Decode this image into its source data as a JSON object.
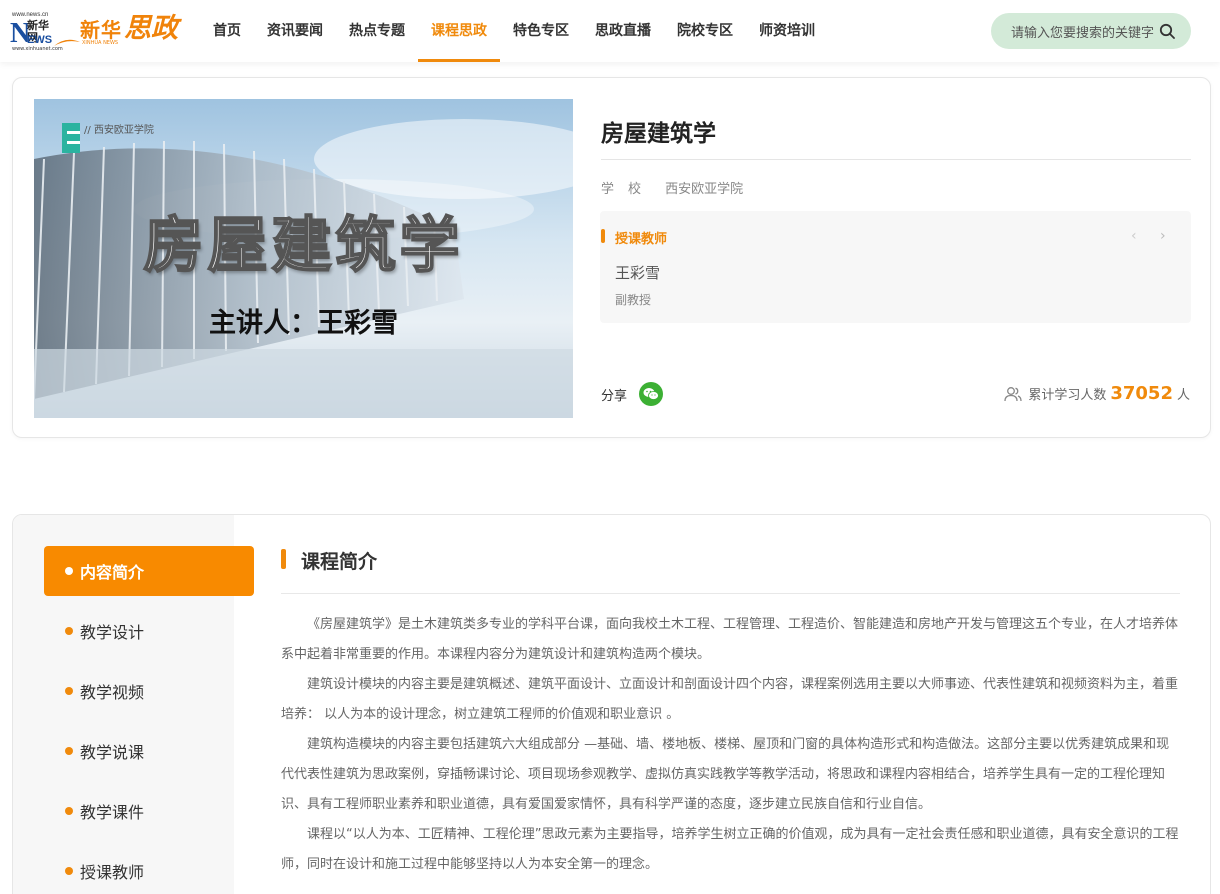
{
  "header": {
    "logo": {
      "url_top": "www.news.cn",
      "n_letter": "N",
      "cn": "新华网",
      "ews": "EWS",
      "url_bottom": "www.xinhuanet.com",
      "brand1": "新华",
      "brand1_sub": "XINHUA NEWS",
      "brand2": "思政"
    },
    "nav": [
      {
        "label": "首页"
      },
      {
        "label": "资讯要闻"
      },
      {
        "label": "热点专题"
      },
      {
        "label": "课程思政"
      },
      {
        "label": "特色专区"
      },
      {
        "label": "思政直播"
      },
      {
        "label": "院校专区"
      },
      {
        "label": "师资培训"
      }
    ],
    "active_nav": "课程思政",
    "search": {
      "placeholder": "请输入您要搜索的关键字",
      "icon": "search-icon"
    }
  },
  "course": {
    "cover": {
      "school_tag": "// 西安欧亚学院",
      "big_title": "房屋建筑学",
      "speaker": "主讲人：王彩雪"
    },
    "title": "房屋建筑学",
    "school_label": "学校",
    "school": "西安欧亚学院",
    "teacher_section_label": "授课教师",
    "teacher": {
      "name": "王彩雪",
      "title": "副教授"
    },
    "share_label": "分享",
    "learners_label": "累计学习人数",
    "learners_count": "37052",
    "learners_unit": "人"
  },
  "sidebar": {
    "items": [
      {
        "label": "内容简介"
      },
      {
        "label": "教学设计"
      },
      {
        "label": "教学视频"
      },
      {
        "label": "教学说课"
      },
      {
        "label": "教学课件"
      },
      {
        "label": "授课教师"
      }
    ],
    "active": "内容简介"
  },
  "content": {
    "section_title": "课程简介",
    "paragraphs": [
      "《房屋建筑学》是土木建筑类多专业的学科平台课，面向我校土木工程、工程管理、工程造价、智能建造和房地产开发与管理这五个专业，在人才培养体系中起着非常重要的作用。本课程内容分为建筑设计和建筑构造两个模块。",
      "建筑设计模块的内容主要是建筑概述、建筑平面设计、立面设计和剖面设计四个内容，课程案例选用主要以大师事迹、代表性建筑和视频资料为主，着重培养： 以人为本的设计理念，树立建筑工程师的价值观和职业意识 。",
      "建筑构造模块的内容主要包括建筑六大组成部分 —基础、墙、楼地板、楼梯、屋顶和门窗的具体构造形式和构造做法。这部分主要以优秀建筑成果和现代代表性建筑为思政案例，穿插畅课讨论、项目现场参观教学、虚拟仿真实践教学等教学活动，将思政和课程内容相结合，培养学生具有一定的工程伦理知识、具有工程师职业素养和职业道德，具有爱国爱家情怀，具有科学严谨的态度，逐步建立民族自信和行业自信。",
      "课程以“以人为本、工匠精神、工程伦理”思政元素为主要指导，培养学生树立正确的价值观，成为具有一定社会责任感和职业道德，具有安全意识的工程师，同时在设计和施工过程中能够坚持以人为本安全第一的理念。"
    ]
  },
  "colors": {
    "accent": "#f08a0c",
    "search_bg": "#d3ead8",
    "wechat": "#3cb034"
  }
}
